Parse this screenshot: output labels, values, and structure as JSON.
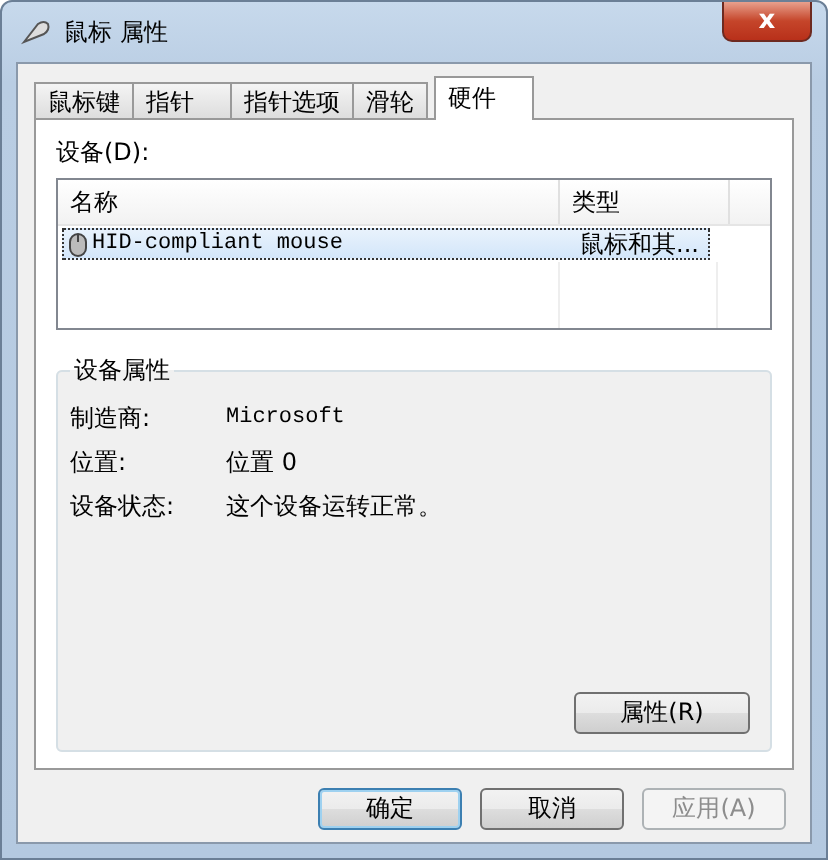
{
  "window": {
    "title": "鼠标 属性",
    "close": "x"
  },
  "tabs": [
    {
      "label": "鼠标键",
      "selected": false
    },
    {
      "label": "指针",
      "selected": false
    },
    {
      "label": "指针选项",
      "selected": false
    },
    {
      "label": "滑轮",
      "selected": false
    },
    {
      "label": "硬件",
      "selected": true
    }
  ],
  "devices": {
    "label": "设备(D):",
    "columns": [
      "名称",
      "类型"
    ],
    "rows": [
      {
        "name": "HID-compliant mouse",
        "type": "鼠标和其...",
        "selected": true
      }
    ]
  },
  "properties": {
    "title": "设备属性",
    "fields": [
      {
        "label": "制造商:",
        "value": "Microsoft",
        "mono": true
      },
      {
        "label": "位置:",
        "value": "位置 0",
        "mono": false
      },
      {
        "label": "设备状态:",
        "value": "这个设备运转正常。",
        "mono": false
      }
    ],
    "button": "属性(R)"
  },
  "buttons": [
    {
      "label": "确定",
      "disabled": false,
      "default": true
    },
    {
      "label": "取消",
      "disabled": false,
      "default": false
    },
    {
      "label": "应用(A)",
      "disabled": true,
      "default": false
    }
  ]
}
